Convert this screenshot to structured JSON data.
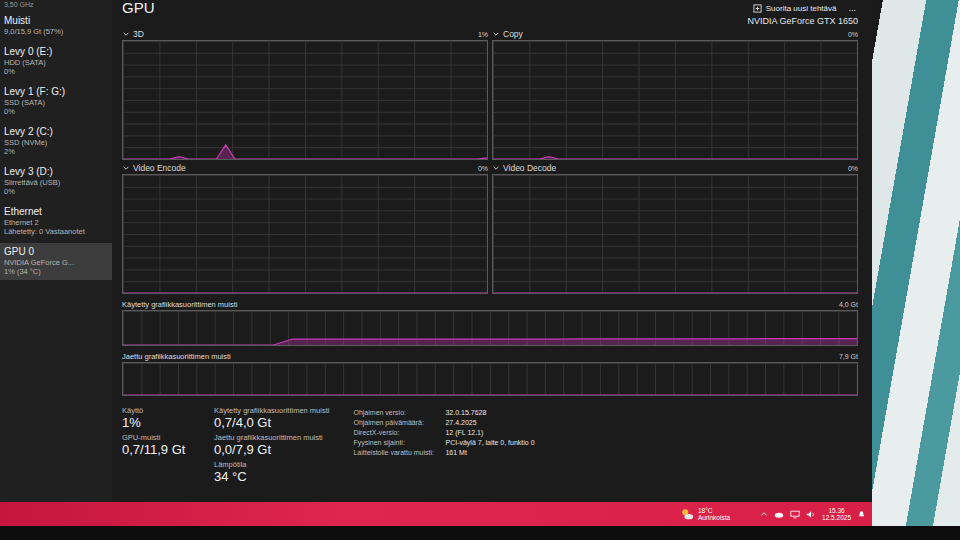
{
  "top_cut": "3,50 GHz",
  "sidebar": {
    "items": [
      {
        "title": "Muisti",
        "lines": [
          "9,0/15,9 Gt (57%)"
        ],
        "selected": false
      },
      {
        "title": "Levy 0 (E:)",
        "lines": [
          "HDD (SATA)",
          "0%"
        ],
        "selected": false
      },
      {
        "title": "Levy 1 (F: G:)",
        "lines": [
          "SSD (SATA)",
          "0%"
        ],
        "selected": false
      },
      {
        "title": "Levy 2 (C:)",
        "lines": [
          "SSD (NVMe)",
          "2%"
        ],
        "selected": false
      },
      {
        "title": "Levy 3 (D:)",
        "lines": [
          "Siirrettävä (USB)",
          "0%"
        ],
        "selected": false
      },
      {
        "title": "Ethernet",
        "lines": [
          "Ethernet 2",
          "Lähetetty: 0 Vastaanotet"
        ],
        "selected": false
      },
      {
        "title": "GPU 0",
        "lines": [
          "NVIDIA GeForce G...",
          "1% (34 °C)"
        ],
        "selected": true
      }
    ]
  },
  "header": {
    "title": "GPU",
    "run_task": "Suorita uusi tehtävä",
    "more": "...",
    "device": "NVIDIA GeForce GTX 1650"
  },
  "engines": [
    {
      "name": "3D",
      "reading": "1%",
      "values": [
        0,
        0,
        0,
        0,
        0,
        0,
        2,
        0,
        0,
        0,
        0,
        12,
        0,
        0,
        0,
        0,
        0,
        0,
        0,
        0,
        0,
        0,
        0,
        0,
        0,
        0,
        0,
        0,
        0,
        0,
        0,
        0,
        0,
        0,
        0,
        0,
        0,
        0,
        0,
        1
      ]
    },
    {
      "name": "Copy",
      "reading": "0%",
      "values": [
        0,
        0,
        0,
        0,
        0,
        0,
        2,
        0,
        0,
        0,
        0,
        0,
        0,
        0,
        0,
        0,
        0,
        0,
        0,
        0,
        0,
        0,
        0,
        0,
        0,
        0,
        0,
        0,
        0,
        0,
        0,
        0,
        0,
        0,
        0,
        0,
        0,
        0,
        0,
        0
      ]
    },
    {
      "name": "Video Encode",
      "reading": "0%",
      "values": [
        0,
        0,
        0,
        0,
        0,
        0,
        0,
        0,
        0,
        0,
        0,
        0,
        0,
        0,
        0,
        0,
        0,
        0,
        0,
        0,
        0,
        0,
        0,
        0,
        0,
        0,
        0,
        0,
        0,
        0,
        0,
        0,
        0,
        0,
        0,
        0,
        0,
        0,
        0,
        0
      ]
    },
    {
      "name": "Video Decode",
      "reading": "0%",
      "values": [
        0,
        0,
        0,
        0,
        0,
        0,
        0,
        0,
        0,
        0,
        0,
        0,
        0,
        0,
        0,
        0,
        0,
        0,
        0,
        0,
        0,
        0,
        0,
        0,
        0,
        0,
        0,
        0,
        0,
        0,
        0,
        0,
        0,
        0,
        0,
        0,
        0,
        0,
        0,
        0
      ]
    }
  ],
  "memory_charts": [
    {
      "label": "Käytetty grafiikkasuorittimen muisti",
      "max_label": "4,0 Gt",
      "max": 4.0,
      "values": [
        0,
        0,
        0,
        0,
        0,
        0,
        0,
        0,
        0,
        0.7,
        0.7,
        0.7,
        0.7,
        0.7,
        0.7,
        0.7,
        0.7,
        0.7,
        0.7,
        0.7,
        0.7,
        0.7,
        0.7,
        0.7,
        0.72,
        0.72,
        0.72,
        0.72,
        0.72,
        0.72,
        0.73,
        0.73,
        0.73,
        0.73,
        0.74,
        0.74,
        0.74,
        0.75,
        0.75,
        0.75
      ]
    },
    {
      "label": "Jaettu grafiikkasuorittimen muisti",
      "max_label": "7,9 Gt",
      "max": 7.9,
      "values": [
        0,
        0,
        0,
        0,
        0,
        0,
        0,
        0,
        0,
        0,
        0,
        0,
        0,
        0,
        0,
        0,
        0,
        0,
        0,
        0,
        0,
        0,
        0,
        0,
        0,
        0,
        0,
        0,
        0,
        0,
        0,
        0,
        0,
        0,
        0,
        0,
        0,
        0,
        0,
        0
      ]
    }
  ],
  "stats": [
    [
      {
        "label": "Käyttö",
        "value": "1%"
      },
      {
        "label": "GPU-muisti",
        "value": "0,7/11,9 Gt"
      }
    ],
    [
      {
        "label": "Käytetty grafiikkasuorittimen muisti",
        "value": "0,7/4,0 Gt"
      },
      {
        "label": "Jaettu grafiikkasuorittimen muisti",
        "value": "0,0/7,9 Gt"
      },
      {
        "label": "Lämpötila",
        "value": "34 °C"
      }
    ]
  ],
  "details": [
    {
      "key": "Ohjaimen versio:",
      "value": "32.0.15.7628"
    },
    {
      "key": "Ohjaimen päivämäärä:",
      "value": "27.4.2025"
    },
    {
      "key": "DirectX-versio:",
      "value": "12 (FL 12.1)"
    },
    {
      "key": "Fyysinen sijainti:",
      "value": "PCI-väylä 7, laite 0, funktio 0"
    },
    {
      "key": "Laitteistolle varattu muisti:",
      "value": "161 Mt"
    }
  ],
  "taskbar": {
    "temperature": "18°C",
    "weather": "Aurinkoista",
    "time": "15.36",
    "date": "12.5.2025"
  }
}
